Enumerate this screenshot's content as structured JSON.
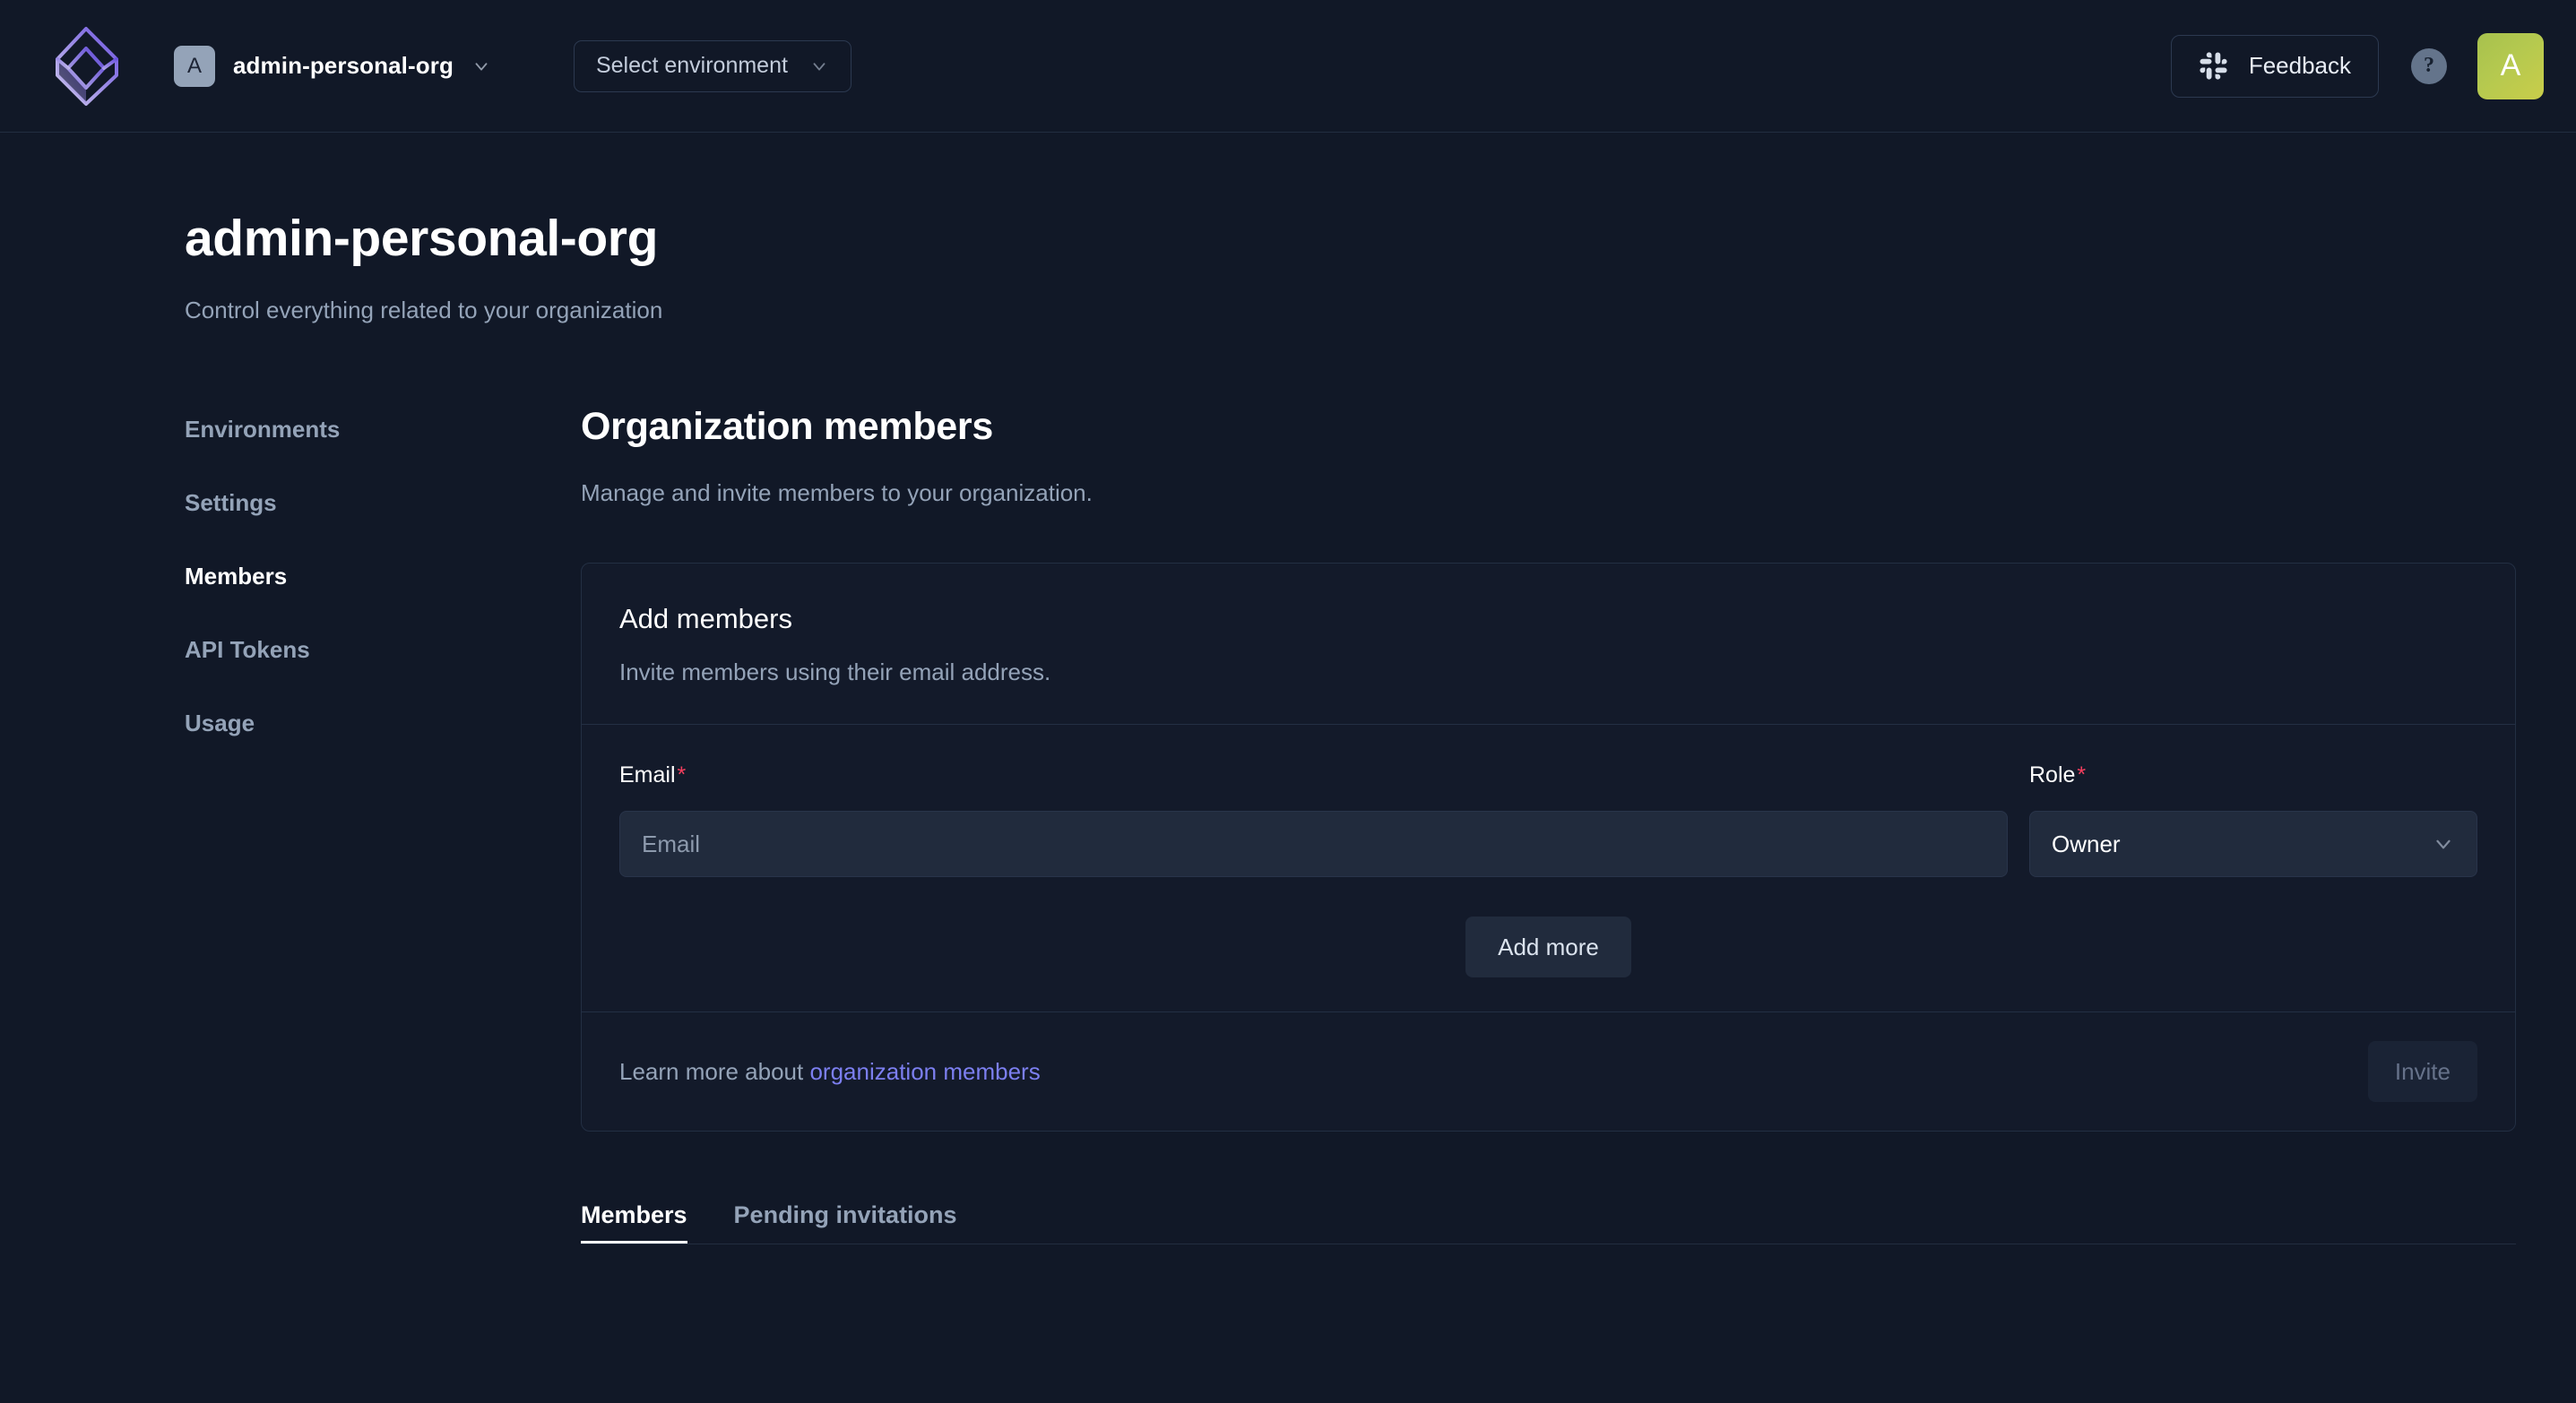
{
  "topbar": {
    "logo_name": "app-logo",
    "org": {
      "avatar_letter": "A",
      "name": "admin-personal-org"
    },
    "environment_select": {
      "label": "Select environment"
    },
    "feedback_button": {
      "label": "Feedback"
    },
    "help_button": {
      "label": "?"
    },
    "user_avatar": {
      "letter": "A"
    }
  },
  "page": {
    "title": "admin-personal-org",
    "subtitle": "Control everything related to your organization"
  },
  "sidenav": {
    "items": [
      {
        "label": "Environments",
        "active": false
      },
      {
        "label": "Settings",
        "active": false
      },
      {
        "label": "Members",
        "active": true
      },
      {
        "label": "API Tokens",
        "active": false
      },
      {
        "label": "Usage",
        "active": false
      }
    ]
  },
  "main": {
    "title": "Organization members",
    "subtitle": "Manage and invite members to your organization.",
    "add_members_card": {
      "heading": "Add members",
      "description": "Invite members using their email address.",
      "email_field": {
        "label": "Email",
        "required_marker": "*",
        "value": "",
        "placeholder": "Email"
      },
      "role_field": {
        "label": "Role",
        "required_marker": "*",
        "selected": "Owner"
      },
      "add_more_button": "Add more",
      "footer": {
        "learn_prefix": "Learn more about ",
        "learn_link": "organization members",
        "invite_button": "Invite"
      }
    },
    "tabs": [
      {
        "label": "Members",
        "active": true
      },
      {
        "label": "Pending invitations",
        "active": false
      }
    ]
  },
  "colors": {
    "background": "#111827",
    "card": "#131a2a",
    "border": "#232f43",
    "input": "#212b3d",
    "accent_link": "#7c7ff0",
    "required": "#f43f5e",
    "muted_text": "#94a3b8",
    "logo_purple": "#6b52e0",
    "avatar_green": "#b5c94f"
  }
}
